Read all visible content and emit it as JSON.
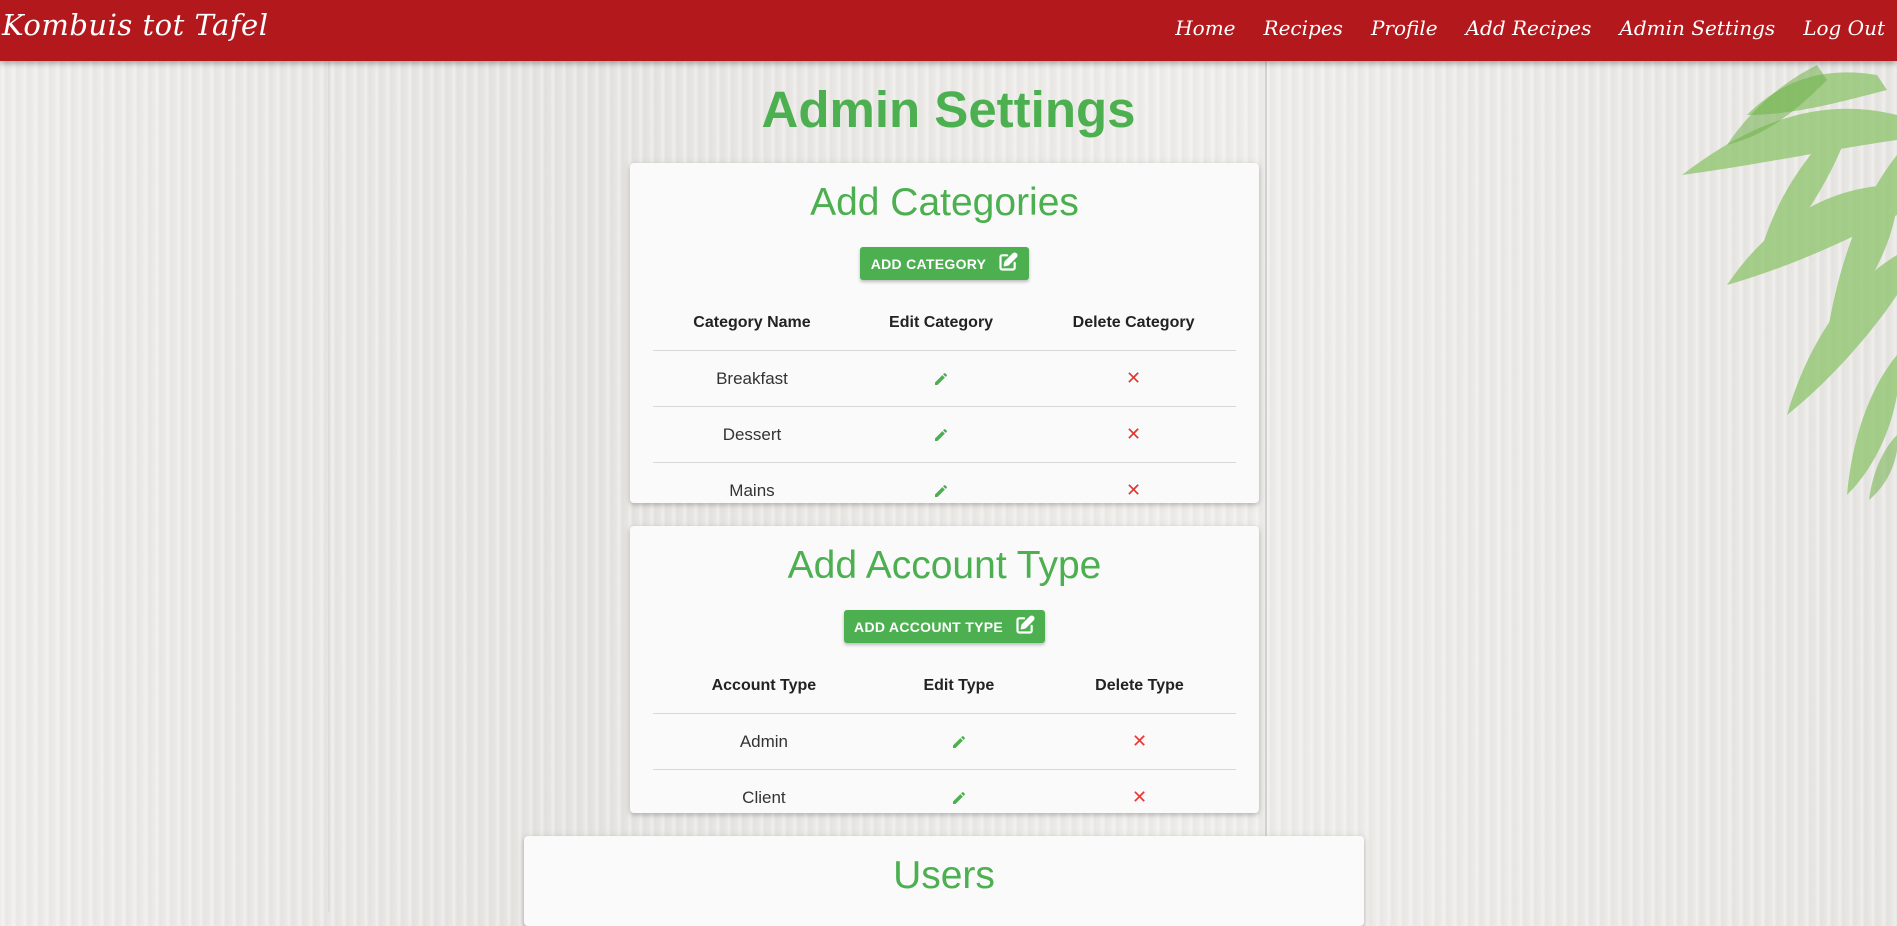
{
  "navbar": {
    "brand": "Kombuis tot Tafel",
    "links": [
      "Home",
      "Recipes",
      "Profile",
      "Add Recipes",
      "Admin Settings",
      "Log Out"
    ]
  },
  "page": {
    "title": "Admin Settings"
  },
  "categories": {
    "title": "Add Categories",
    "button_label": "ADD CATEGORY",
    "headers": [
      "Category Name",
      "Edit Category",
      "Delete Category"
    ],
    "rows": [
      "Breakfast",
      "Dessert",
      "Mains"
    ]
  },
  "account_types": {
    "title": "Add Account Type",
    "button_label": "ADD ACCOUNT TYPE",
    "headers": [
      "Account Type",
      "Edit Type",
      "Delete Type"
    ],
    "rows": [
      "Admin",
      "Client"
    ]
  },
  "users": {
    "title": "Users"
  },
  "icons": {
    "edit": "pencil-icon",
    "delete": "close-icon",
    "button": "edit-square-icon"
  },
  "colors": {
    "navbar": "#b3191c",
    "accent": "#4caf50",
    "delete": "#e53935"
  }
}
